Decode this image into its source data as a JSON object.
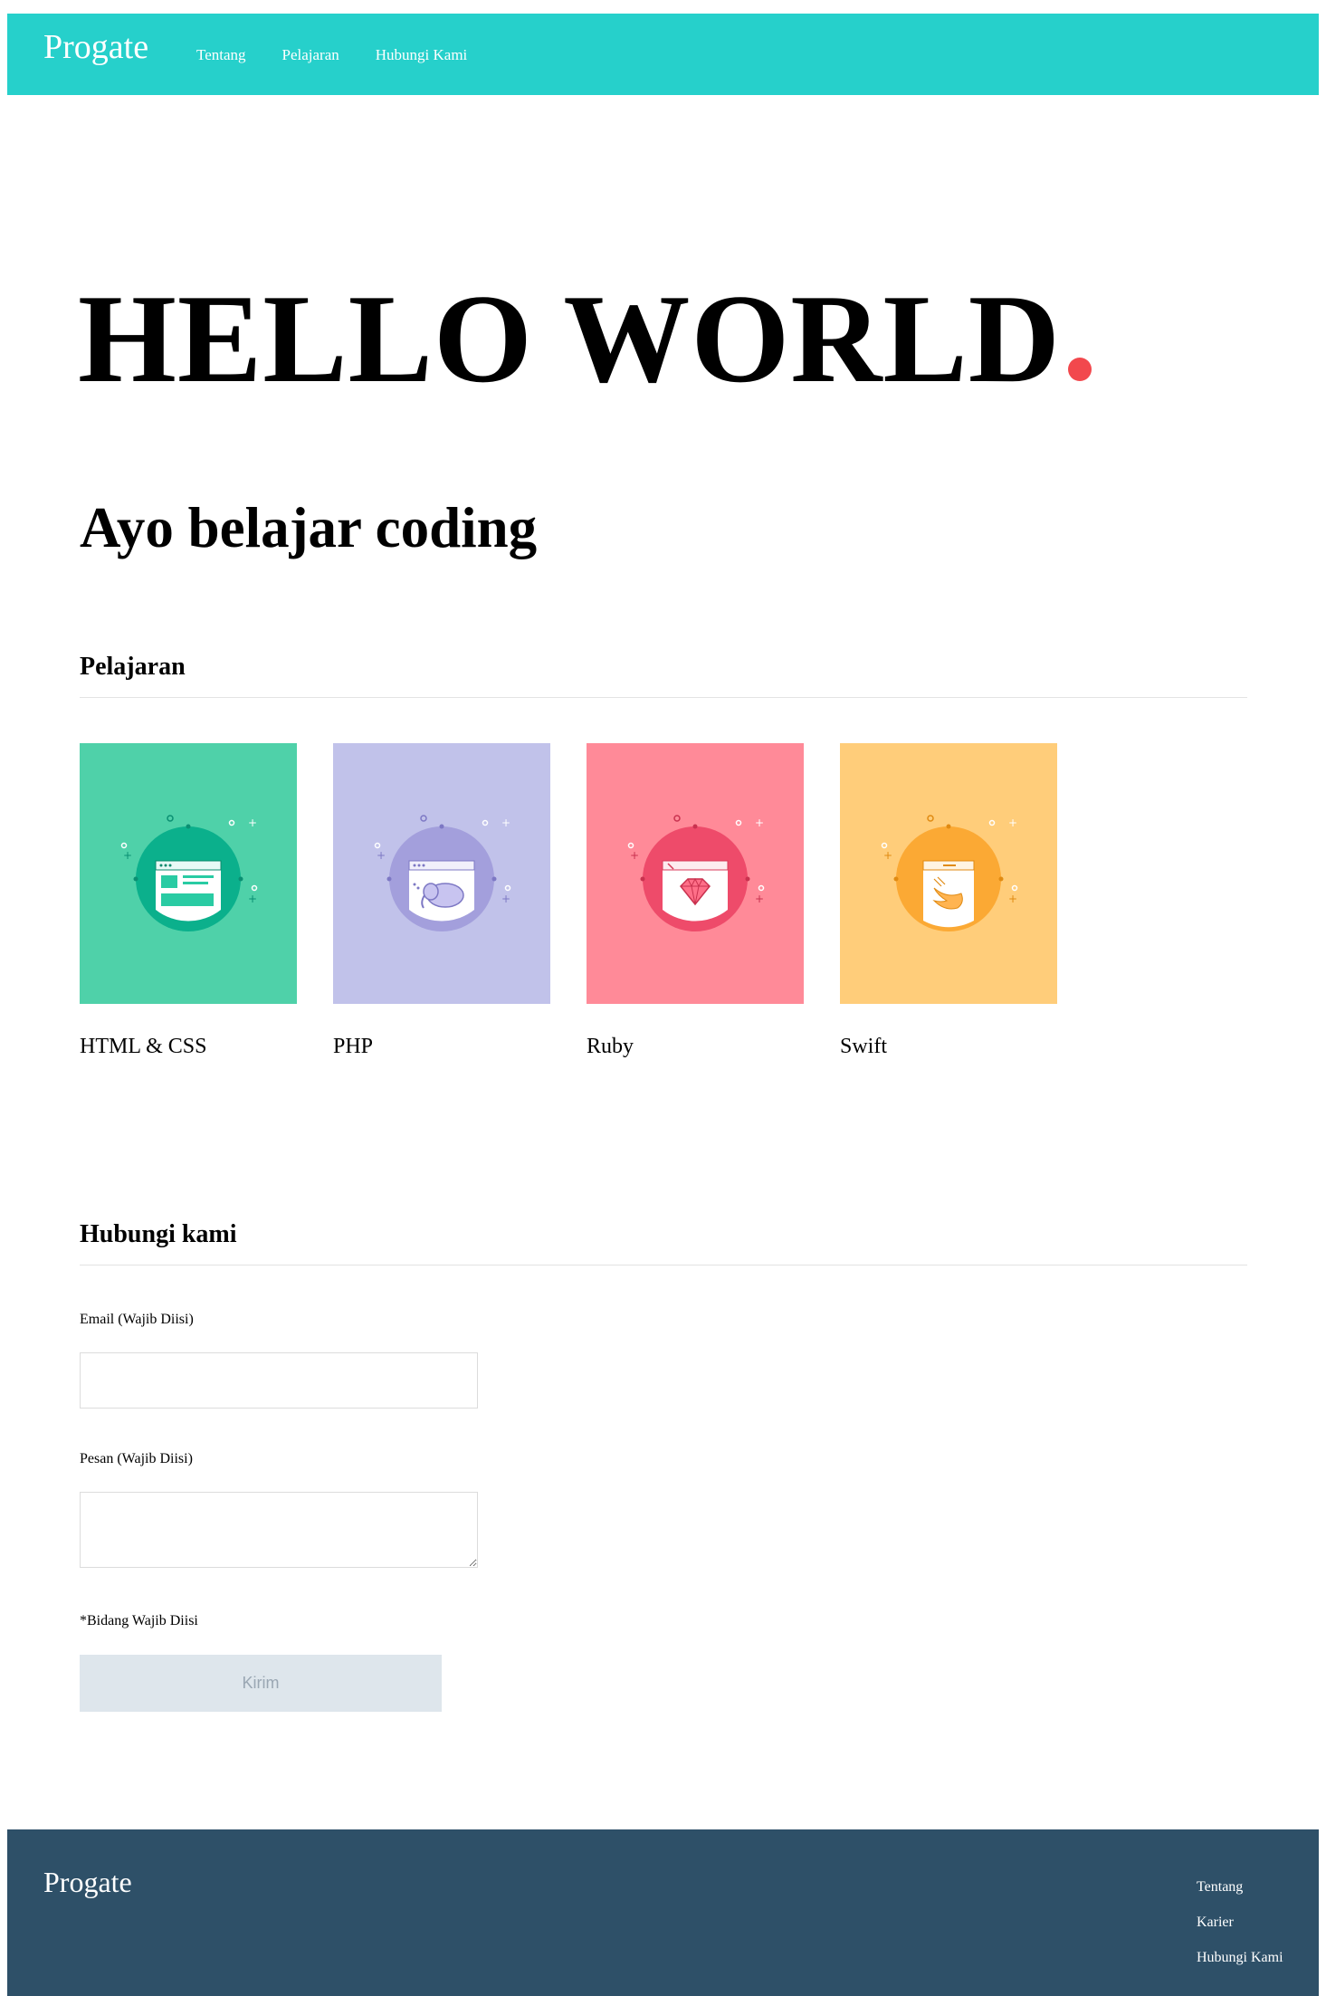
{
  "header": {
    "logo": "Progate",
    "nav": [
      "Tentang",
      "Pelajaran",
      "Hubungi Kami"
    ]
  },
  "hero": {
    "title": "HELLO WORLD",
    "subtitle": "Ayo belajar coding",
    "accent_color": "#f2484d"
  },
  "lessons": {
    "heading": "Pelajaran",
    "items": [
      {
        "name": "HTML & CSS",
        "bg": "#4fd1a9",
        "circle": "#0bb08c",
        "icon": "browser-layout-icon"
      },
      {
        "name": "PHP",
        "bg": "#c1c2ea",
        "circle": "#a39fdc",
        "icon": "elephant-icon"
      },
      {
        "name": "Ruby",
        "bg": "#ff8a98",
        "circle": "#ee4b6a",
        "icon": "gem-icon"
      },
      {
        "name": "Swift",
        "bg": "#ffcd7a",
        "circle": "#fba934",
        "icon": "swift-bird-icon"
      }
    ]
  },
  "contact": {
    "heading": "Hubungi kami",
    "email_label": "Email (Wajib Diisi)",
    "message_label": "Pesan (Wajib Diisi)",
    "required_note": "*Bidang Wajib Diisi",
    "submit_label": "Kirim"
  },
  "footer": {
    "logo": "Progate",
    "links": [
      "Tentang",
      "Karier",
      "Hubungi Kami"
    ]
  },
  "colors": {
    "header_bg": "#26d0cb",
    "footer_bg": "#2e5068",
    "button_bg": "#dee6ec"
  }
}
